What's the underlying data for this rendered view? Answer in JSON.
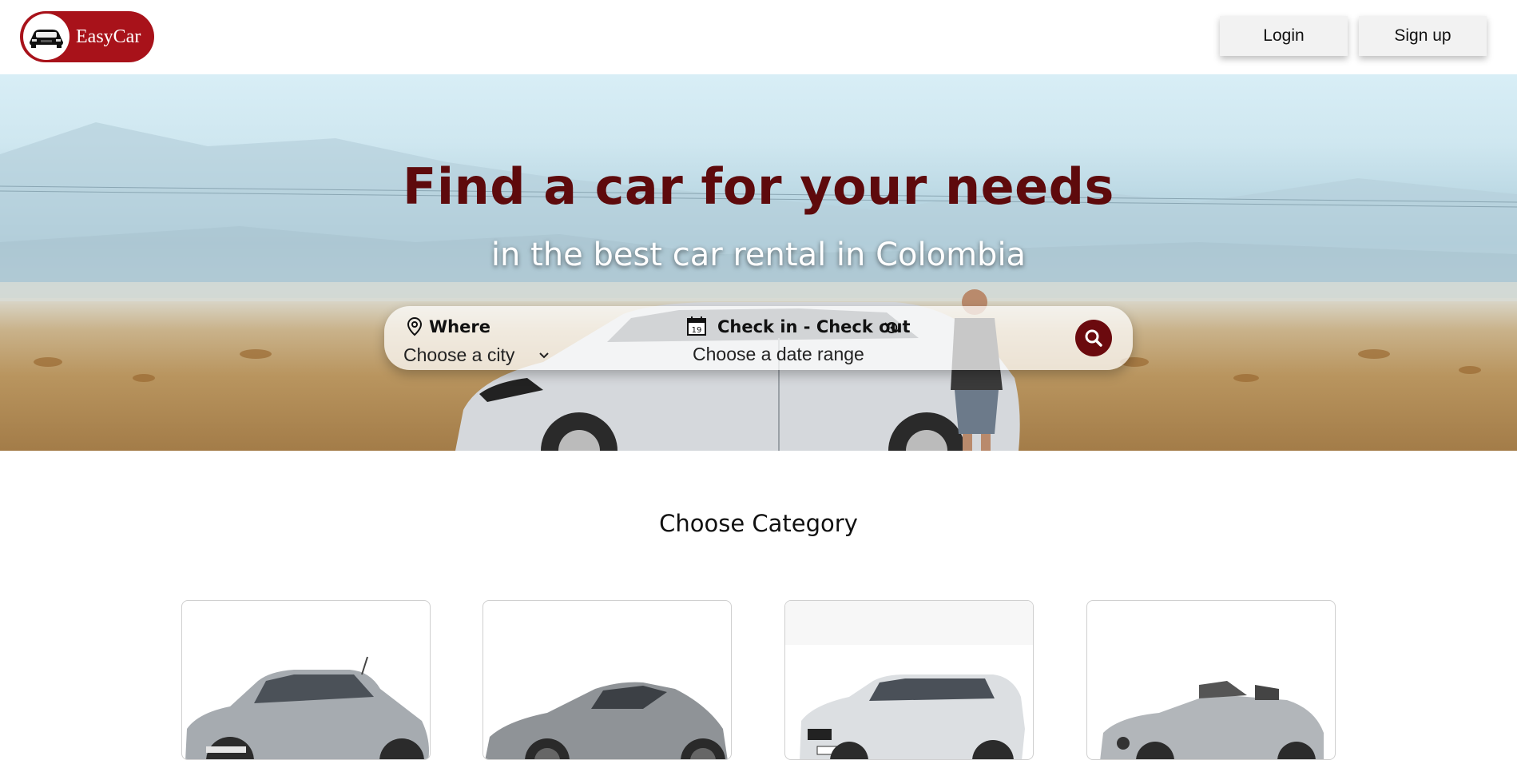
{
  "brand": {
    "name": "EasyCar",
    "color": "#a8121a"
  },
  "header": {
    "login_label": "Login",
    "signup_label": "Sign up"
  },
  "hero": {
    "title": "Find a car for your needs",
    "subtitle": "in the best car rental in Colombia",
    "title_color": "#5e0a0c"
  },
  "search": {
    "where_label": "Where",
    "where_value": "Choose a city",
    "dates_label": "Check in - Check out",
    "dates_value": "Choose a date range",
    "calendar_day": "19",
    "button_color": "#6b0a0e"
  },
  "category": {
    "title": "Choose Category",
    "cards": [
      {
        "icon": "hatchback-car-image"
      },
      {
        "icon": "sports-car-image"
      },
      {
        "icon": "suv-car-image"
      },
      {
        "icon": "convertible-car-image"
      }
    ]
  }
}
